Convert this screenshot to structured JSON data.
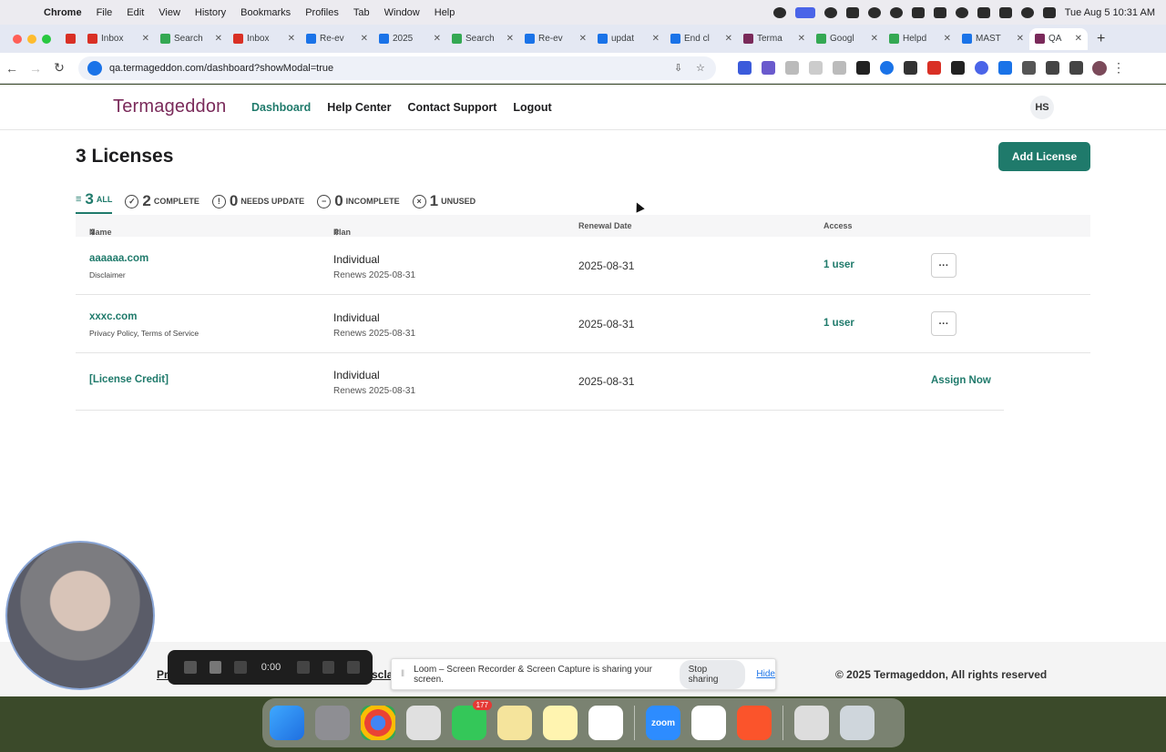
{
  "menubar": {
    "app": "Chrome",
    "menus": [
      "File",
      "Edit",
      "View",
      "History",
      "Bookmarks",
      "Profiles",
      "Tab",
      "Window",
      "Help"
    ],
    "clock": "Tue Aug 5  10:31 AM"
  },
  "tabs": [
    {
      "label": "",
      "color": "#d93025"
    },
    {
      "label": "Inbox",
      "color": "#d93025"
    },
    {
      "label": "Search",
      "color": "#34a853"
    },
    {
      "label": "Inbox",
      "color": "#d93025"
    },
    {
      "label": "Re-ev",
      "color": "#1a73e8"
    },
    {
      "label": "2025",
      "color": "#1a73e8"
    },
    {
      "label": "Search",
      "color": "#34a853"
    },
    {
      "label": "Re-ev",
      "color": "#1a73e8"
    },
    {
      "label": "updat",
      "color": "#1a73e8"
    },
    {
      "label": "End cl",
      "color": "#1a73e8"
    },
    {
      "label": "Terma",
      "color": "#7a2a5a"
    },
    {
      "label": "Googl",
      "color": "#34a853"
    },
    {
      "label": "Helpd",
      "color": "#34a853"
    },
    {
      "label": "MAST",
      "color": "#1a73e8"
    },
    {
      "label": "QA",
      "color": "#7a2a5a"
    }
  ],
  "browser": {
    "url": "qa.termageddon.com/dashboard?showModal=true"
  },
  "site": {
    "logo": "Termageddon",
    "nav": [
      "Dashboard",
      "Help Center",
      "Contact Support",
      "Logout"
    ],
    "avatar": "HS"
  },
  "main": {
    "title": "3 Licenses",
    "add_button": "Add License",
    "filters": [
      {
        "count": "3",
        "label": "ALL"
      },
      {
        "count": "2",
        "label": "COMPLETE"
      },
      {
        "count": "0",
        "label": "NEEDS UPDATE"
      },
      {
        "count": "0",
        "label": "INCOMPLETE"
      },
      {
        "count": "1",
        "label": "UNUSED"
      }
    ],
    "columns": [
      "Name",
      "Plan",
      "Renewal Date",
      "Access"
    ],
    "rows": [
      {
        "name": "aaaaaa.com",
        "sub": "Disclaimer",
        "plan": "Individual",
        "renews": "Renews 2025-08-31",
        "date": "2025-08-31",
        "access": "1 user",
        "action": "···"
      },
      {
        "name": "xxxc.com",
        "sub": "Privacy Policy, Terms of Service",
        "plan": "Individual",
        "renews": "Renews 2025-08-31",
        "date": "2025-08-31",
        "access": "1 user",
        "action": "···"
      },
      {
        "name": "[License Credit]",
        "sub": "",
        "plan": "Individual",
        "renews": "Renews 2025-08-31",
        "date": "2025-08-31",
        "access": "",
        "action": "Assign Now"
      }
    ]
  },
  "footer": {
    "link1": "Pr",
    "link2": "scla",
    "copyright": "© 2025 Termageddon, All rights reserved"
  },
  "loom": {
    "timer": "0:00",
    "message": "Loom – Screen Recorder & Screen Capture is sharing your screen.",
    "stop": "Stop sharing",
    "hide": "Hide"
  },
  "dock": {
    "messages_badge": "177",
    "zoom_label": "zoom"
  }
}
